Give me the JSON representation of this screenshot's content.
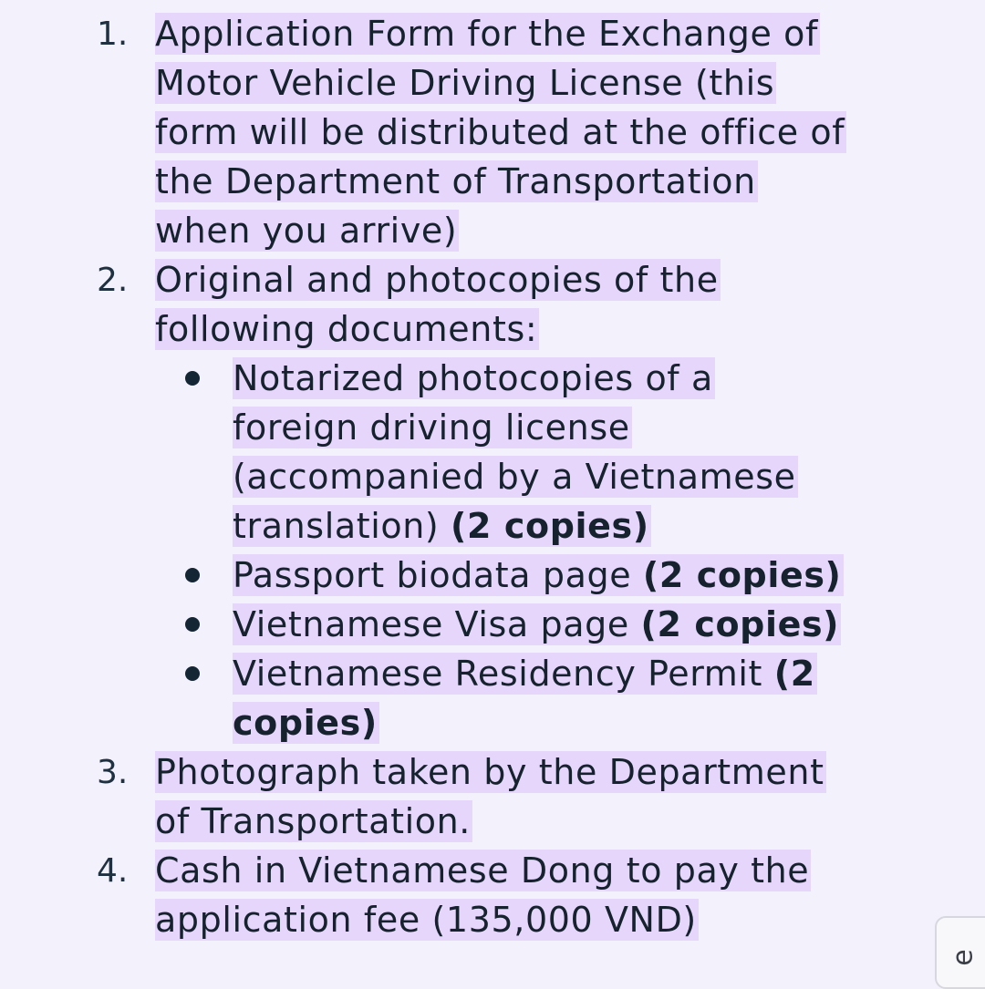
{
  "items": [
    {
      "number": "1.",
      "lines": [
        "Application Form for the Exchange of",
        "Motor Vehicle Driving License (this",
        "form will be distributed at the office of",
        "the Department of Transportation",
        "when you arrive)"
      ]
    },
    {
      "number": "2.",
      "lines": [
        "Original and photocopies of the",
        "following documents:"
      ],
      "subitems": [
        {
          "lines": [
            "Notarized photocopies of a",
            "foreign driving license",
            "(accompanied by a Vietnamese"
          ],
          "last_line_text": "translation) ",
          "last_line_bold": "(2 copies)"
        },
        {
          "text": "Passport biodata page ",
          "bold": "(2 copies)"
        },
        {
          "text": "Vietnamese Visa page ",
          "bold": "(2 copies)"
        },
        {
          "text": "Vietnamese Residency Permit ",
          "bold_line1": "(2",
          "bold_line2": "copies)"
        }
      ]
    },
    {
      "number": "3.",
      "lines": [
        "Photograph taken by the Department",
        "of Transportation."
      ]
    },
    {
      "number": "4.",
      "lines": [
        "Cash in Vietnamese Dong to pay the",
        "application fee (135,000 VND)"
      ]
    }
  ],
  "floating_button": {
    "label": "e"
  }
}
